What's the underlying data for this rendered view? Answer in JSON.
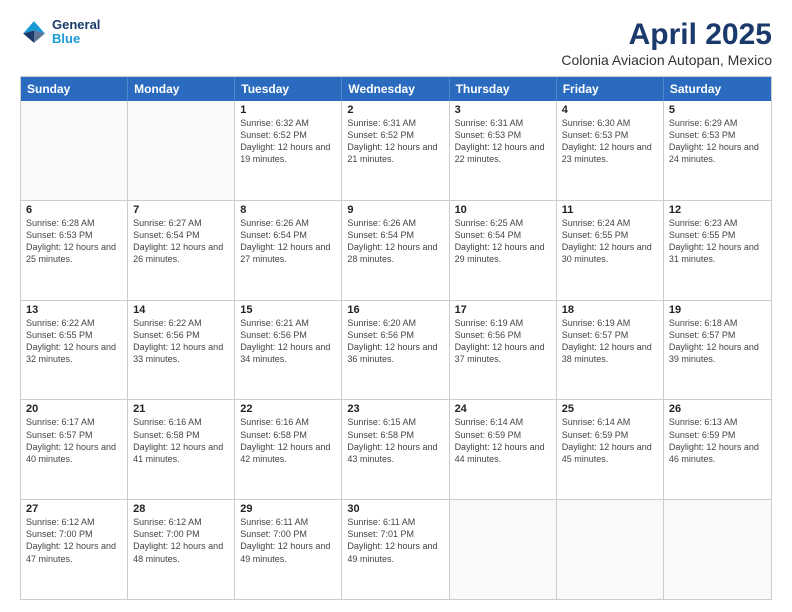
{
  "header": {
    "logo": {
      "line1": "General",
      "line2": "Blue"
    },
    "title": "April 2025",
    "subtitle": "Colonia Aviacion Autopan, Mexico"
  },
  "weekdays": [
    "Sunday",
    "Monday",
    "Tuesday",
    "Wednesday",
    "Thursday",
    "Friday",
    "Saturday"
  ],
  "weeks": [
    [
      {
        "day": "",
        "info": ""
      },
      {
        "day": "",
        "info": ""
      },
      {
        "day": "1",
        "info": "Sunrise: 6:32 AM\nSunset: 6:52 PM\nDaylight: 12 hours and 19 minutes."
      },
      {
        "day": "2",
        "info": "Sunrise: 6:31 AM\nSunset: 6:52 PM\nDaylight: 12 hours and 21 minutes."
      },
      {
        "day": "3",
        "info": "Sunrise: 6:31 AM\nSunset: 6:53 PM\nDaylight: 12 hours and 22 minutes."
      },
      {
        "day": "4",
        "info": "Sunrise: 6:30 AM\nSunset: 6:53 PM\nDaylight: 12 hours and 23 minutes."
      },
      {
        "day": "5",
        "info": "Sunrise: 6:29 AM\nSunset: 6:53 PM\nDaylight: 12 hours and 24 minutes."
      }
    ],
    [
      {
        "day": "6",
        "info": "Sunrise: 6:28 AM\nSunset: 6:53 PM\nDaylight: 12 hours and 25 minutes."
      },
      {
        "day": "7",
        "info": "Sunrise: 6:27 AM\nSunset: 6:54 PM\nDaylight: 12 hours and 26 minutes."
      },
      {
        "day": "8",
        "info": "Sunrise: 6:26 AM\nSunset: 6:54 PM\nDaylight: 12 hours and 27 minutes."
      },
      {
        "day": "9",
        "info": "Sunrise: 6:26 AM\nSunset: 6:54 PM\nDaylight: 12 hours and 28 minutes."
      },
      {
        "day": "10",
        "info": "Sunrise: 6:25 AM\nSunset: 6:54 PM\nDaylight: 12 hours and 29 minutes."
      },
      {
        "day": "11",
        "info": "Sunrise: 6:24 AM\nSunset: 6:55 PM\nDaylight: 12 hours and 30 minutes."
      },
      {
        "day": "12",
        "info": "Sunrise: 6:23 AM\nSunset: 6:55 PM\nDaylight: 12 hours and 31 minutes."
      }
    ],
    [
      {
        "day": "13",
        "info": "Sunrise: 6:22 AM\nSunset: 6:55 PM\nDaylight: 12 hours and 32 minutes."
      },
      {
        "day": "14",
        "info": "Sunrise: 6:22 AM\nSunset: 6:56 PM\nDaylight: 12 hours and 33 minutes."
      },
      {
        "day": "15",
        "info": "Sunrise: 6:21 AM\nSunset: 6:56 PM\nDaylight: 12 hours and 34 minutes."
      },
      {
        "day": "16",
        "info": "Sunrise: 6:20 AM\nSunset: 6:56 PM\nDaylight: 12 hours and 36 minutes."
      },
      {
        "day": "17",
        "info": "Sunrise: 6:19 AM\nSunset: 6:56 PM\nDaylight: 12 hours and 37 minutes."
      },
      {
        "day": "18",
        "info": "Sunrise: 6:19 AM\nSunset: 6:57 PM\nDaylight: 12 hours and 38 minutes."
      },
      {
        "day": "19",
        "info": "Sunrise: 6:18 AM\nSunset: 6:57 PM\nDaylight: 12 hours and 39 minutes."
      }
    ],
    [
      {
        "day": "20",
        "info": "Sunrise: 6:17 AM\nSunset: 6:57 PM\nDaylight: 12 hours and 40 minutes."
      },
      {
        "day": "21",
        "info": "Sunrise: 6:16 AM\nSunset: 6:58 PM\nDaylight: 12 hours and 41 minutes."
      },
      {
        "day": "22",
        "info": "Sunrise: 6:16 AM\nSunset: 6:58 PM\nDaylight: 12 hours and 42 minutes."
      },
      {
        "day": "23",
        "info": "Sunrise: 6:15 AM\nSunset: 6:58 PM\nDaylight: 12 hours and 43 minutes."
      },
      {
        "day": "24",
        "info": "Sunrise: 6:14 AM\nSunset: 6:59 PM\nDaylight: 12 hours and 44 minutes."
      },
      {
        "day": "25",
        "info": "Sunrise: 6:14 AM\nSunset: 6:59 PM\nDaylight: 12 hours and 45 minutes."
      },
      {
        "day": "26",
        "info": "Sunrise: 6:13 AM\nSunset: 6:59 PM\nDaylight: 12 hours and 46 minutes."
      }
    ],
    [
      {
        "day": "27",
        "info": "Sunrise: 6:12 AM\nSunset: 7:00 PM\nDaylight: 12 hours and 47 minutes."
      },
      {
        "day": "28",
        "info": "Sunrise: 6:12 AM\nSunset: 7:00 PM\nDaylight: 12 hours and 48 minutes."
      },
      {
        "day": "29",
        "info": "Sunrise: 6:11 AM\nSunset: 7:00 PM\nDaylight: 12 hours and 49 minutes."
      },
      {
        "day": "30",
        "info": "Sunrise: 6:11 AM\nSunset: 7:01 PM\nDaylight: 12 hours and 49 minutes."
      },
      {
        "day": "",
        "info": ""
      },
      {
        "day": "",
        "info": ""
      },
      {
        "day": "",
        "info": ""
      }
    ]
  ]
}
